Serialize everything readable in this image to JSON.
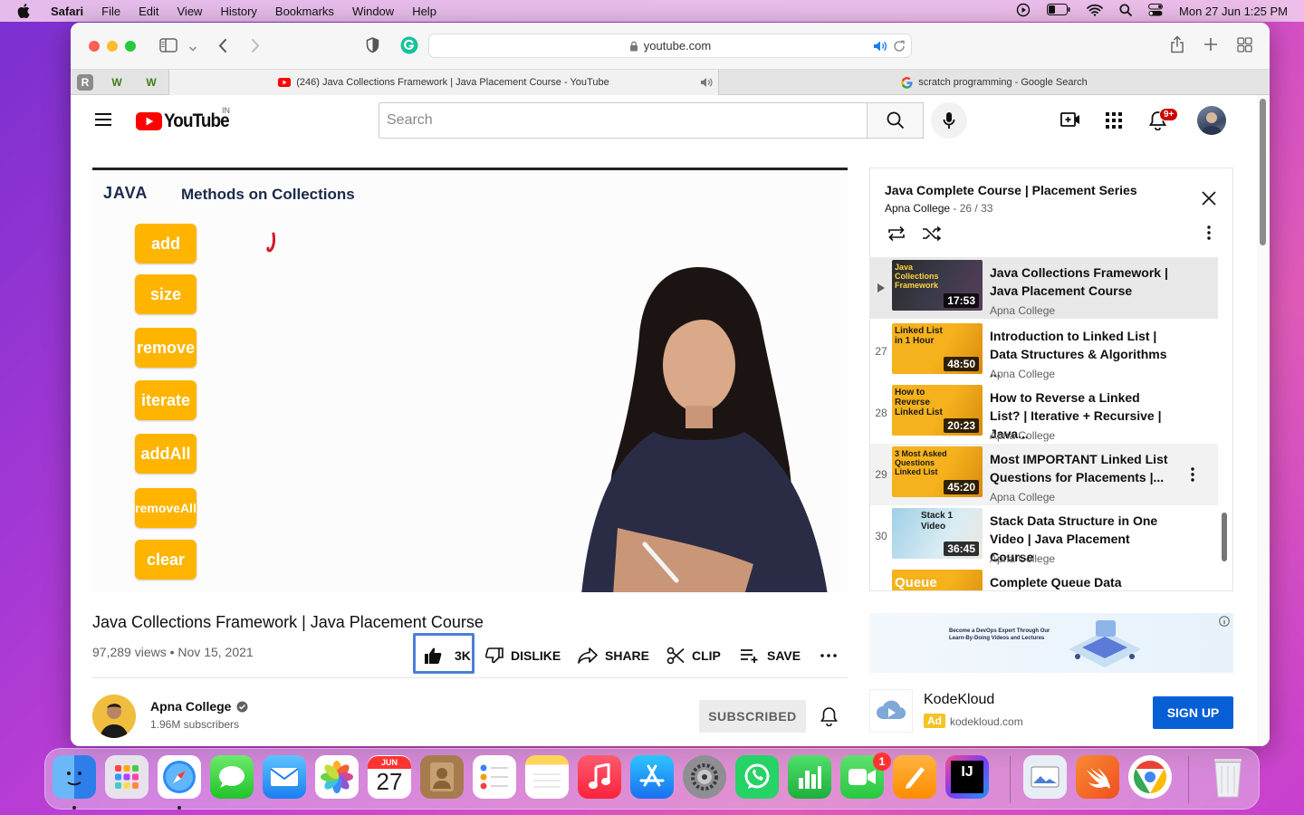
{
  "menubar": {
    "app": "Safari",
    "items": [
      "File",
      "Edit",
      "View",
      "History",
      "Bookmarks",
      "Window",
      "Help"
    ],
    "datetime": "Mon 27 Jun  1:25 PM"
  },
  "browser": {
    "url": "youtube.com",
    "tabs": [
      {
        "title": "(246) Java Collections Framework | Java Placement Course - YouTube"
      },
      {
        "title": "scratch programming - Google Search"
      }
    ],
    "pinned": [
      "R",
      "W",
      "W"
    ]
  },
  "youtube": {
    "logo": "YouTube",
    "region": "IN",
    "search_placeholder": "Search",
    "notifications": "9+",
    "video": {
      "title": "Java Collections Framework | Java Placement Course",
      "views": "97,289 views",
      "date": "Nov 15, 2021",
      "likes": "3K",
      "dislike": "DISLIKE",
      "share": "SHARE",
      "clip": "CLIP",
      "save": "SAVE",
      "slide": {
        "heading_left": "JAVA",
        "heading_right": "Methods on Collections",
        "buttons": [
          "add",
          "size",
          "remove",
          "iterate",
          "addAll",
          "removeAll",
          "clear"
        ]
      }
    },
    "channel": {
      "name": "Apna College",
      "subscribers": "1.96M subscribers",
      "subscribe_label": "SUBSCRIBED"
    },
    "playlist": {
      "title": "Java Complete Course | Placement Series",
      "channel": "Apna College",
      "position": "26 / 33",
      "items": [
        {
          "num": "",
          "title": "Java Collections Framework | Java Placement Course",
          "channel": "Apna College",
          "duration": "17:53",
          "thumb_label": "Java Collections Framework"
        },
        {
          "num": "27",
          "title": "Introduction to Linked List | Data Structures & Algorithms ...",
          "channel": "Apna College",
          "duration": "48:50",
          "thumb_label": "Linked List in 1 Hour"
        },
        {
          "num": "28",
          "title": "How to Reverse a Linked List? | Iterative + Recursive | Java...",
          "channel": "Apna College",
          "duration": "20:23",
          "thumb_label": "How to Reverse Linked List"
        },
        {
          "num": "29",
          "title": "Most IMPORTANT Linked List Questions for Placements |...",
          "channel": "Apna College",
          "duration": "45:20",
          "thumb_label": "3 Most Asked Questions Linked List"
        },
        {
          "num": "30",
          "title": "Stack Data Structure in One Video | Java Placement Course",
          "channel": "Apna College",
          "duration": "36:45",
          "thumb_label": "Stack 1 Video"
        },
        {
          "num": "",
          "title": "Complete Queue Data",
          "channel": "",
          "duration": "",
          "thumb_label": "Queue"
        }
      ]
    },
    "ad": {
      "banner_text": "Become a DevOps Expert Through Our Learn-By-Doing Videos and Lectures",
      "name": "KodeKloud",
      "badge": "Ad",
      "domain": "kodekloud.com",
      "cta": "SIGN UP"
    }
  },
  "dock": {
    "calendar_month": "JUN",
    "calendar_day": "27",
    "facetime_badge": "1",
    "intellij": "IJ"
  }
}
